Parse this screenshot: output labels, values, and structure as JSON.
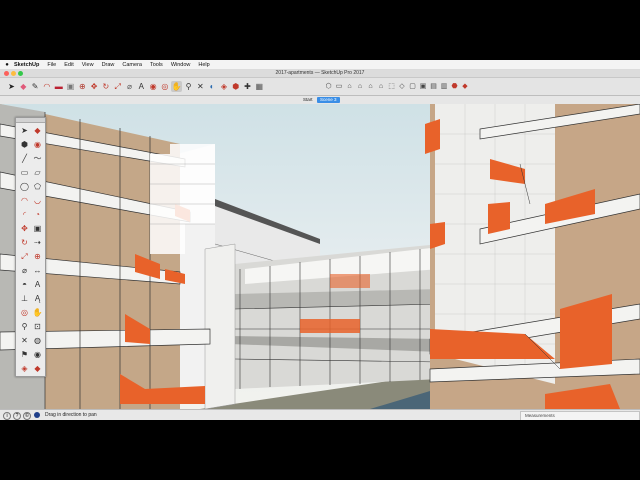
{
  "menubar": {
    "apple": "",
    "items": [
      "SketchUp",
      "File",
      "Edit",
      "View",
      "Draw",
      "Camera",
      "Tools",
      "Window",
      "Help"
    ]
  },
  "window": {
    "title": "2017-apartments — SketchUp Pro 2017",
    "traffic_lights": [
      "#fc605b",
      "#fdbc40",
      "#34c84a"
    ]
  },
  "toolbar": {
    "tools": [
      {
        "name": "select-tool",
        "glyph": "➤",
        "color": "#222"
      },
      {
        "name": "eraser-tool",
        "glyph": "◆",
        "color": "#e05a7a"
      },
      {
        "name": "pencil-tool",
        "glyph": "✎",
        "color": "#333"
      },
      {
        "name": "arc-tool",
        "glyph": "◠",
        "color": "#c0392b"
      },
      {
        "name": "rectangle-tool",
        "glyph": "▬",
        "color": "#b23"
      },
      {
        "name": "pushpull-tool",
        "glyph": "▣",
        "color": "#777"
      },
      {
        "name": "offset-tool",
        "glyph": "⊕",
        "color": "#b03a2e"
      },
      {
        "name": "move-tool",
        "glyph": "✥",
        "color": "#c0392b"
      },
      {
        "name": "rotate-tool",
        "glyph": "↻",
        "color": "#c0392b"
      },
      {
        "name": "scale-tool",
        "glyph": "⤢",
        "color": "#c0392b"
      },
      {
        "name": "tape-measure-tool",
        "glyph": "⌀",
        "color": "#555"
      },
      {
        "name": "text-tool",
        "glyph": "A",
        "color": "#333"
      },
      {
        "name": "paint-bucket-tool",
        "glyph": "◉",
        "color": "#c0392b"
      },
      {
        "name": "orbit-tool",
        "glyph": "◎",
        "color": "#c0392b"
      },
      {
        "name": "pan-tool",
        "glyph": "✋",
        "color": "#333"
      },
      {
        "name": "zoom-tool",
        "glyph": "⚲",
        "color": "#333"
      },
      {
        "name": "zoom-extents-tool",
        "glyph": "✕",
        "color": "#333"
      },
      {
        "name": "previous-view-tool",
        "glyph": "◐",
        "color": "#2b6cb0"
      },
      {
        "name": "section-plane-tool",
        "glyph": "◈",
        "color": "#c0392b"
      },
      {
        "name": "warehouse-tool",
        "glyph": "⬢",
        "color": "#c0392b"
      },
      {
        "name": "extension-tool",
        "glyph": "✚",
        "color": "#333"
      },
      {
        "name": "layout-tool",
        "glyph": "▦",
        "color": "#555"
      }
    ],
    "views": [
      {
        "name": "iso-view",
        "glyph": "⬡"
      },
      {
        "name": "top-view",
        "glyph": "▭"
      },
      {
        "name": "front-view",
        "glyph": "⌂"
      },
      {
        "name": "right-view",
        "glyph": "⌂"
      },
      {
        "name": "back-view",
        "glyph": "⌂"
      },
      {
        "name": "left-view",
        "glyph": "⌂"
      },
      {
        "name": "xray-style",
        "glyph": "⬚"
      },
      {
        "name": "wireframe-style",
        "glyph": "◇"
      },
      {
        "name": "hidden-line-style",
        "glyph": "▢"
      },
      {
        "name": "shaded-style",
        "glyph": "▣"
      },
      {
        "name": "textured-style",
        "glyph": "▤"
      },
      {
        "name": "monochrome-style",
        "glyph": "▥"
      },
      {
        "name": "component-tool",
        "glyph": "⬣"
      },
      {
        "name": "ruby-console-tool",
        "glyph": "◆"
      }
    ]
  },
  "scene_tabs": [
    "Start",
    "Scene 3"
  ],
  "palette": {
    "tools": [
      [
        "select",
        "➤"
      ],
      [
        "eraser",
        "◆"
      ],
      [
        "component",
        "⬢"
      ],
      [
        "paint",
        "◉"
      ],
      [
        "line",
        "╱"
      ],
      [
        "freehand",
        "〜"
      ],
      [
        "rect",
        "▭"
      ],
      [
        "rot-rect",
        "▱"
      ],
      [
        "circle",
        "◯"
      ],
      [
        "polygon",
        "⬠"
      ],
      [
        "arc",
        "◠"
      ],
      [
        "arc2",
        "◡"
      ],
      [
        "arc3",
        "◜"
      ],
      [
        "pie",
        "◔"
      ],
      [
        "move",
        "✥"
      ],
      [
        "pushpull",
        "▣"
      ],
      [
        "rotate",
        "↻"
      ],
      [
        "followme",
        "⇢"
      ],
      [
        "scale",
        "⤢"
      ],
      [
        "offset",
        "⊕"
      ],
      [
        "tape",
        "⌀"
      ],
      [
        "dimension",
        "↔"
      ],
      [
        "protractor",
        "◓"
      ],
      [
        "text",
        "A"
      ],
      [
        "axes",
        "⊥"
      ],
      [
        "3dtext",
        "Ą"
      ],
      [
        "orbit",
        "◎"
      ],
      [
        "pan",
        "✋"
      ],
      [
        "zoom",
        "⚲"
      ],
      [
        "zoomwin",
        "⊡"
      ],
      [
        "extents",
        "✕"
      ],
      [
        "position",
        "◍"
      ],
      [
        "walk",
        "⚑"
      ],
      [
        "lookaround",
        "◉"
      ],
      [
        "section",
        "◈"
      ],
      [
        "sectionfill",
        "◆"
      ]
    ]
  },
  "status": {
    "text": "Drag in direction to pan",
    "measurements_label": "Measurements",
    "measurements_value": ""
  }
}
